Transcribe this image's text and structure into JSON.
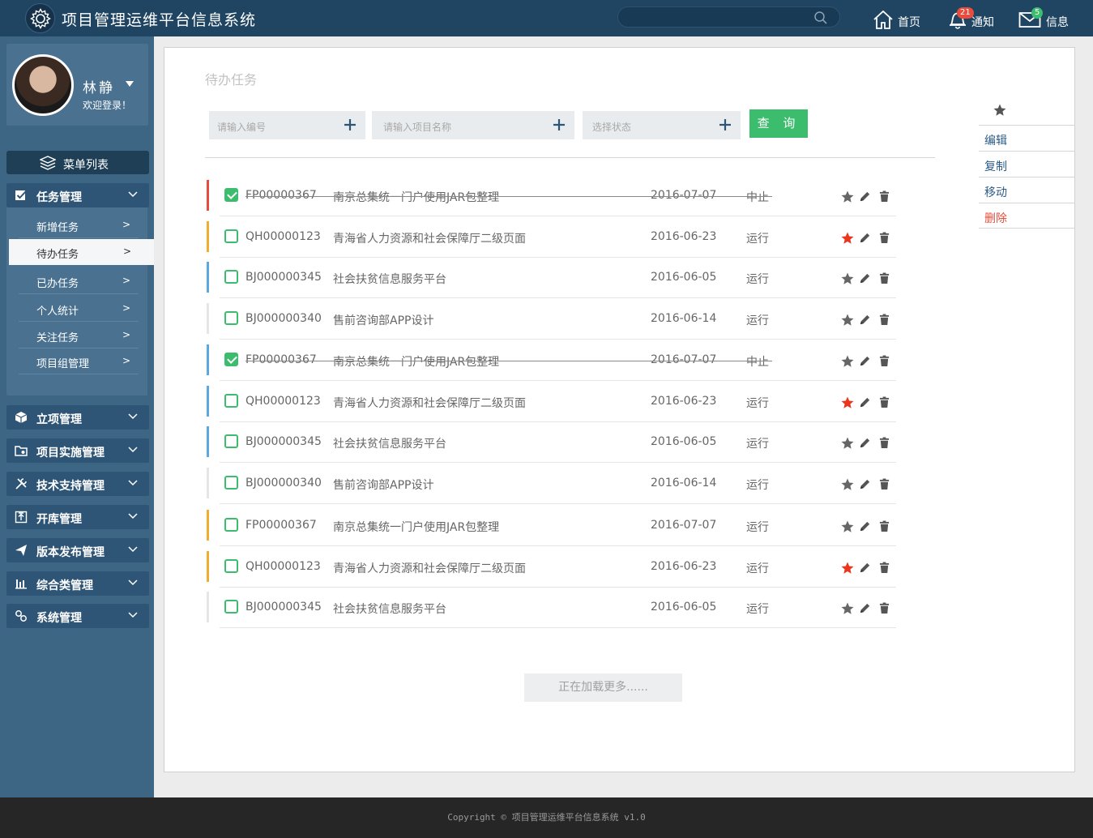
{
  "app": {
    "title": "项目管理运维平台信息系统"
  },
  "search": {
    "placeholder": ""
  },
  "nav": {
    "home": "首页",
    "notify": "通知",
    "notify_count": "21",
    "message": "信息",
    "message_count": "5"
  },
  "user": {
    "name": "林静",
    "welcome": "欢迎登录！"
  },
  "sidebar": {
    "menu_title": "菜单列表",
    "task_group": "任务管理",
    "task_items": [
      {
        "label": "新增任务",
        "arrow": ">"
      },
      {
        "label": "待办任务",
        "arrow": ">"
      },
      {
        "label": "已办任务",
        "arrow": ">"
      },
      {
        "label": "个人统计",
        "arrow": ">"
      },
      {
        "label": "关注任务",
        "arrow": ">"
      },
      {
        "label": "项目组管理",
        "arrow": ">"
      }
    ],
    "groups": [
      {
        "label": "立项管理",
        "icon": "cube-icon"
      },
      {
        "label": "项目实施管理",
        "icon": "folder-icon"
      },
      {
        "label": "技术支持管理",
        "icon": "tools-icon"
      },
      {
        "label": "开库管理",
        "icon": "upload-icon"
      },
      {
        "label": "版本发布管理",
        "icon": "send-icon"
      },
      {
        "label": "综合类管理",
        "icon": "bar-chart-icon"
      },
      {
        "label": "系统管理",
        "icon": "gear-link-icon"
      }
    ]
  },
  "main": {
    "title": "待办任务",
    "filters": {
      "code_placeholder": "请输入编号",
      "name_placeholder": "请输入项目名称",
      "status_placeholder": "选择状态",
      "query_label": "查 询"
    },
    "tasks": [
      {
        "code": "FP00000367",
        "name": "南京总集统一门户使用JAR包整理",
        "date": "2016-07-07",
        "status": "中止",
        "checked": true,
        "strike": true,
        "starred": false,
        "bar": "#e74c3c"
      },
      {
        "code": "QH00000123",
        "name": "青海省人力资源和社会保障厅二级页面",
        "date": "2016-06-23",
        "status": "运行",
        "checked": false,
        "strike": false,
        "starred": true,
        "bar": "#f0ad2e"
      },
      {
        "code": "BJ000000345",
        "name": "社会扶贫信息服务平台",
        "date": "2016-06-05",
        "status": "运行",
        "checked": false,
        "strike": false,
        "starred": false,
        "bar": "#5aa9e0"
      },
      {
        "code": "BJ000000340",
        "name": "售前咨询部APP设计",
        "date": "2016-06-14",
        "status": "运行",
        "checked": false,
        "strike": false,
        "starred": false,
        "bar": "#e6e6e6"
      },
      {
        "code": "FP00000367",
        "name": "南京总集统一门户使用JAR包整理",
        "date": "2016-07-07",
        "status": "中止",
        "checked": true,
        "strike": true,
        "starred": false,
        "bar": "#5aa9e0"
      },
      {
        "code": "QH00000123",
        "name": "青海省人力资源和社会保障厅二级页面",
        "date": "2016-06-23",
        "status": "运行",
        "checked": false,
        "strike": false,
        "starred": true,
        "bar": "#5aa9e0"
      },
      {
        "code": "BJ000000345",
        "name": "社会扶贫信息服务平台",
        "date": "2016-06-05",
        "status": "运行",
        "checked": false,
        "strike": false,
        "starred": false,
        "bar": "#5aa9e0"
      },
      {
        "code": "BJ000000340",
        "name": "售前咨询部APP设计",
        "date": "2016-06-14",
        "status": "运行",
        "checked": false,
        "strike": false,
        "starred": false,
        "bar": "#e6e6e6"
      },
      {
        "code": "FP00000367",
        "name": "南京总集统一门户使用JAR包整理",
        "date": "2016-07-07",
        "status": "运行",
        "checked": false,
        "strike": false,
        "starred": false,
        "bar": "#f0ad2e"
      },
      {
        "code": "QH00000123",
        "name": "青海省人力资源和社会保障厅二级页面",
        "date": "2016-06-23",
        "status": "运行",
        "checked": false,
        "strike": false,
        "starred": true,
        "bar": "#f0ad2e"
      },
      {
        "code": "BJ000000345",
        "name": "社会扶贫信息服务平台",
        "date": "2016-06-05",
        "status": "运行",
        "checked": false,
        "strike": false,
        "starred": false,
        "bar": "#e6e6e6"
      }
    ],
    "load_more": "正在加载更多......"
  },
  "context_menu": {
    "edit": "编辑",
    "copy": "复制",
    "move": "移动",
    "delete": "删除"
  },
  "footer": {
    "text": "Copyright © 项目管理运维平台信息系统 v1.0"
  },
  "colors": {
    "topbar": "#1f4562",
    "sidebar": "#3d6584",
    "accent_green": "#3cbc6d",
    "star_red": "#e8361f",
    "danger": "#e74c3c"
  }
}
